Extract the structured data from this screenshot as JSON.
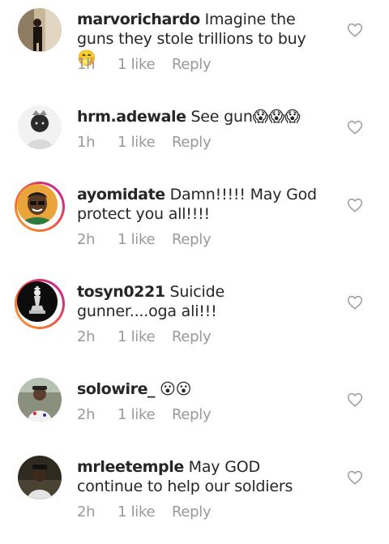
{
  "comments": [
    {
      "username": "marvorichardo",
      "text": "Imagine the guns they stole trillions to buy 🤭",
      "time": "1h",
      "likes": "1 like",
      "reply": "Reply",
      "avatar_ring": false
    },
    {
      "username": "hrm.adewale",
      "text": "See gun😱😱😱",
      "time": "1h",
      "likes": "1 like",
      "reply": "Reply",
      "avatar_ring": false
    },
    {
      "username": "ayomidate",
      "text": "Damn!!!!! May God protect you all!!!!",
      "time": "2h",
      "likes": "1 like",
      "reply": "Reply",
      "avatar_ring": true
    },
    {
      "username": "tosyn0221",
      "text": "Suicide gunner....oga ali!!!",
      "time": "2h",
      "likes": "1 like",
      "reply": "Reply",
      "avatar_ring": true
    },
    {
      "username": "solowire_",
      "text": "😮😮",
      "time": "2h",
      "likes": "1 like",
      "reply": "Reply",
      "avatar_ring": false
    },
    {
      "username": "mrleetemple",
      "text": "May GOD continue to help our soldiers",
      "time": "2h",
      "likes": "1 like",
      "reply": "Reply",
      "avatar_ring": false
    }
  ],
  "icons": {
    "like": "heart-outline-icon"
  },
  "colors": {
    "text": "#262626",
    "meta": "#999999",
    "story_ring_start": "#f9a233",
    "story_ring_end": "#b92a9a"
  }
}
